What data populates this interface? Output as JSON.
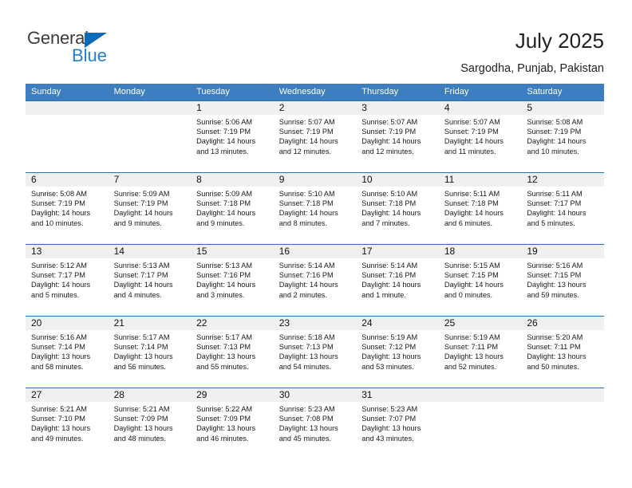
{
  "brand": {
    "name_part1": "General",
    "name_part2": "Blue",
    "colors": {
      "dark": "#3b3b3b",
      "blue": "#1f7fd0",
      "triangle": "#0d6bb5"
    }
  },
  "header": {
    "title": "July 2025",
    "location": "Sargodha, Punjab, Pakistan"
  },
  "theme": {
    "header_bg": "#3c7ebf",
    "row_line": "#2f6fae",
    "daynum_bg": "#f0f0f0"
  },
  "weekdays": [
    "Sunday",
    "Monday",
    "Tuesday",
    "Wednesday",
    "Thursday",
    "Friday",
    "Saturday"
  ],
  "weeks": [
    [
      {
        "day": "",
        "empty": true
      },
      {
        "day": "",
        "empty": true
      },
      {
        "day": "1",
        "sunrise": "Sunrise: 5:06 AM",
        "sunset": "Sunset: 7:19 PM",
        "daylight1": "Daylight: 14 hours",
        "daylight2": "and 13 minutes."
      },
      {
        "day": "2",
        "sunrise": "Sunrise: 5:07 AM",
        "sunset": "Sunset: 7:19 PM",
        "daylight1": "Daylight: 14 hours",
        "daylight2": "and 12 minutes."
      },
      {
        "day": "3",
        "sunrise": "Sunrise: 5:07 AM",
        "sunset": "Sunset: 7:19 PM",
        "daylight1": "Daylight: 14 hours",
        "daylight2": "and 12 minutes."
      },
      {
        "day": "4",
        "sunrise": "Sunrise: 5:07 AM",
        "sunset": "Sunset: 7:19 PM",
        "daylight1": "Daylight: 14 hours",
        "daylight2": "and 11 minutes."
      },
      {
        "day": "5",
        "sunrise": "Sunrise: 5:08 AM",
        "sunset": "Sunset: 7:19 PM",
        "daylight1": "Daylight: 14 hours",
        "daylight2": "and 10 minutes."
      }
    ],
    [
      {
        "day": "6",
        "sunrise": "Sunrise: 5:08 AM",
        "sunset": "Sunset: 7:19 PM",
        "daylight1": "Daylight: 14 hours",
        "daylight2": "and 10 minutes."
      },
      {
        "day": "7",
        "sunrise": "Sunrise: 5:09 AM",
        "sunset": "Sunset: 7:19 PM",
        "daylight1": "Daylight: 14 hours",
        "daylight2": "and 9 minutes."
      },
      {
        "day": "8",
        "sunrise": "Sunrise: 5:09 AM",
        "sunset": "Sunset: 7:18 PM",
        "daylight1": "Daylight: 14 hours",
        "daylight2": "and 9 minutes."
      },
      {
        "day": "9",
        "sunrise": "Sunrise: 5:10 AM",
        "sunset": "Sunset: 7:18 PM",
        "daylight1": "Daylight: 14 hours",
        "daylight2": "and 8 minutes."
      },
      {
        "day": "10",
        "sunrise": "Sunrise: 5:10 AM",
        "sunset": "Sunset: 7:18 PM",
        "daylight1": "Daylight: 14 hours",
        "daylight2": "and 7 minutes."
      },
      {
        "day": "11",
        "sunrise": "Sunrise: 5:11 AM",
        "sunset": "Sunset: 7:18 PM",
        "daylight1": "Daylight: 14 hours",
        "daylight2": "and 6 minutes."
      },
      {
        "day": "12",
        "sunrise": "Sunrise: 5:11 AM",
        "sunset": "Sunset: 7:17 PM",
        "daylight1": "Daylight: 14 hours",
        "daylight2": "and 5 minutes."
      }
    ],
    [
      {
        "day": "13",
        "sunrise": "Sunrise: 5:12 AM",
        "sunset": "Sunset: 7:17 PM",
        "daylight1": "Daylight: 14 hours",
        "daylight2": "and 5 minutes."
      },
      {
        "day": "14",
        "sunrise": "Sunrise: 5:13 AM",
        "sunset": "Sunset: 7:17 PM",
        "daylight1": "Daylight: 14 hours",
        "daylight2": "and 4 minutes."
      },
      {
        "day": "15",
        "sunrise": "Sunrise: 5:13 AM",
        "sunset": "Sunset: 7:16 PM",
        "daylight1": "Daylight: 14 hours",
        "daylight2": "and 3 minutes."
      },
      {
        "day": "16",
        "sunrise": "Sunrise: 5:14 AM",
        "sunset": "Sunset: 7:16 PM",
        "daylight1": "Daylight: 14 hours",
        "daylight2": "and 2 minutes."
      },
      {
        "day": "17",
        "sunrise": "Sunrise: 5:14 AM",
        "sunset": "Sunset: 7:16 PM",
        "daylight1": "Daylight: 14 hours",
        "daylight2": "and 1 minute."
      },
      {
        "day": "18",
        "sunrise": "Sunrise: 5:15 AM",
        "sunset": "Sunset: 7:15 PM",
        "daylight1": "Daylight: 14 hours",
        "daylight2": "and 0 minutes."
      },
      {
        "day": "19",
        "sunrise": "Sunrise: 5:16 AM",
        "sunset": "Sunset: 7:15 PM",
        "daylight1": "Daylight: 13 hours",
        "daylight2": "and 59 minutes."
      }
    ],
    [
      {
        "day": "20",
        "sunrise": "Sunrise: 5:16 AM",
        "sunset": "Sunset: 7:14 PM",
        "daylight1": "Daylight: 13 hours",
        "daylight2": "and 58 minutes."
      },
      {
        "day": "21",
        "sunrise": "Sunrise: 5:17 AM",
        "sunset": "Sunset: 7:14 PM",
        "daylight1": "Daylight: 13 hours",
        "daylight2": "and 56 minutes."
      },
      {
        "day": "22",
        "sunrise": "Sunrise: 5:17 AM",
        "sunset": "Sunset: 7:13 PM",
        "daylight1": "Daylight: 13 hours",
        "daylight2": "and 55 minutes."
      },
      {
        "day": "23",
        "sunrise": "Sunrise: 5:18 AM",
        "sunset": "Sunset: 7:13 PM",
        "daylight1": "Daylight: 13 hours",
        "daylight2": "and 54 minutes."
      },
      {
        "day": "24",
        "sunrise": "Sunrise: 5:19 AM",
        "sunset": "Sunset: 7:12 PM",
        "daylight1": "Daylight: 13 hours",
        "daylight2": "and 53 minutes."
      },
      {
        "day": "25",
        "sunrise": "Sunrise: 5:19 AM",
        "sunset": "Sunset: 7:11 PM",
        "daylight1": "Daylight: 13 hours",
        "daylight2": "and 52 minutes."
      },
      {
        "day": "26",
        "sunrise": "Sunrise: 5:20 AM",
        "sunset": "Sunset: 7:11 PM",
        "daylight1": "Daylight: 13 hours",
        "daylight2": "and 50 minutes."
      }
    ],
    [
      {
        "day": "27",
        "sunrise": "Sunrise: 5:21 AM",
        "sunset": "Sunset: 7:10 PM",
        "daylight1": "Daylight: 13 hours",
        "daylight2": "and 49 minutes."
      },
      {
        "day": "28",
        "sunrise": "Sunrise: 5:21 AM",
        "sunset": "Sunset: 7:09 PM",
        "daylight1": "Daylight: 13 hours",
        "daylight2": "and 48 minutes."
      },
      {
        "day": "29",
        "sunrise": "Sunrise: 5:22 AM",
        "sunset": "Sunset: 7:09 PM",
        "daylight1": "Daylight: 13 hours",
        "daylight2": "and 46 minutes."
      },
      {
        "day": "30",
        "sunrise": "Sunrise: 5:23 AM",
        "sunset": "Sunset: 7:08 PM",
        "daylight1": "Daylight: 13 hours",
        "daylight2": "and 45 minutes."
      },
      {
        "day": "31",
        "sunrise": "Sunrise: 5:23 AM",
        "sunset": "Sunset: 7:07 PM",
        "daylight1": "Daylight: 13 hours",
        "daylight2": "and 43 minutes."
      },
      {
        "day": "",
        "empty": true
      },
      {
        "day": "",
        "empty": true
      }
    ]
  ]
}
